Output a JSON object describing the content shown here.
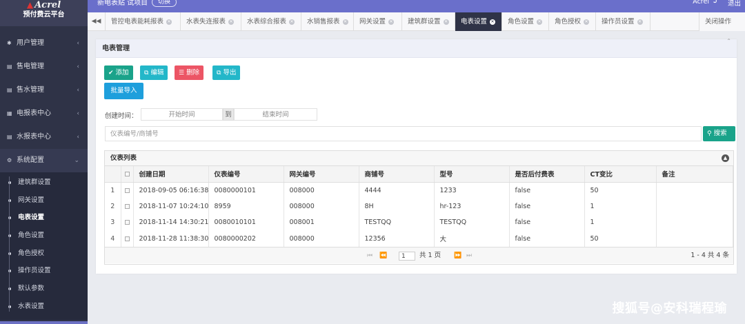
{
  "app": {
    "brand": "Acrel",
    "platform": "预付费云平台"
  },
  "topbar": {
    "project": "新电表贴 试项目",
    "switch_label": "切换",
    "user": "Acrel",
    "logout_label": "退出"
  },
  "sidebar": {
    "items": [
      {
        "label": "用户管理",
        "icon": "asterisk-icon"
      },
      {
        "label": "售电管理",
        "icon": "card-icon"
      },
      {
        "label": "售水管理",
        "icon": "card-icon"
      },
      {
        "label": "电报表中心",
        "icon": "table-icon"
      },
      {
        "label": "水报表中心",
        "icon": "card-icon"
      },
      {
        "label": "系统配置",
        "icon": "gear-icon"
      }
    ],
    "sub_items": [
      {
        "label": "建筑群设置"
      },
      {
        "label": "网关设置"
      },
      {
        "label": "电表设置"
      },
      {
        "label": "角色设置"
      },
      {
        "label": "角色授权"
      },
      {
        "label": "操作员设置"
      },
      {
        "label": "默认参数"
      },
      {
        "label": "水表设置"
      }
    ]
  },
  "tabs": [
    {
      "label": "管控电表能耗报表"
    },
    {
      "label": "水表失连报表"
    },
    {
      "label": "水表综合报表"
    },
    {
      "label": "水销售报表"
    },
    {
      "label": "网关设置"
    },
    {
      "label": "建筑群设置"
    },
    {
      "label": "电表设置"
    },
    {
      "label": "角色设置"
    },
    {
      "label": "角色授权"
    },
    {
      "label": "操作员设置"
    }
  ],
  "tab_close_others": "关闭操作",
  "panel": {
    "title": "电表管理",
    "buttons": {
      "add": "添加",
      "edit": "编辑",
      "delete": "删除",
      "export": "导出",
      "import": "批量导入"
    },
    "create_time_label": "创建时间：",
    "start_placeholder": "开始时间",
    "to_label": "到",
    "end_placeholder": "结束时间",
    "search_placeholder": "仪表编号/商铺号",
    "search_button": "搜索"
  },
  "grid": {
    "caption": "仪表列表",
    "columns": [
      "创建日期",
      "仪表编号",
      "网关编号",
      "商铺号",
      "型号",
      "是否后付费表",
      "CT变比",
      "备注"
    ],
    "rows": [
      {
        "num": "1",
        "date": "2018-09-05 06:16:38",
        "meter": "0080000101",
        "gateway": "008000",
        "shop": "4444",
        "model": "1233",
        "postpaid": "false",
        "ct": "50",
        "note": ""
      },
      {
        "num": "2",
        "date": "2018-11-07 10:24:10",
        "meter": "8959",
        "gateway": "008000",
        "shop": "8H",
        "model": "hr-123",
        "postpaid": "false",
        "ct": "1",
        "note": ""
      },
      {
        "num": "3",
        "date": "2018-11-14 14:30:21",
        "meter": "0080010101",
        "gateway": "008001",
        "shop": "TESTQQ",
        "model": "TESTQQ",
        "postpaid": "false",
        "ct": "1",
        "note": ""
      },
      {
        "num": "4",
        "date": "2018-11-28 11:38:30",
        "meter": "0080000202",
        "gateway": "008000",
        "shop": "12356",
        "model": "大",
        "postpaid": "false",
        "ct": "50",
        "note": ""
      }
    ],
    "pager": {
      "page": "1",
      "of_label": "共 1 页",
      "info": "1 - 4   共 4 条"
    }
  },
  "watermark": "搜狐号@安科瑞程瑜",
  "colors": {
    "sidebar": "#2f3347",
    "topbar": "#6a6fcb",
    "add": "#1aa38a",
    "edit": "#23b7c9",
    "delete": "#ec5565",
    "import": "#1e9fdc"
  }
}
